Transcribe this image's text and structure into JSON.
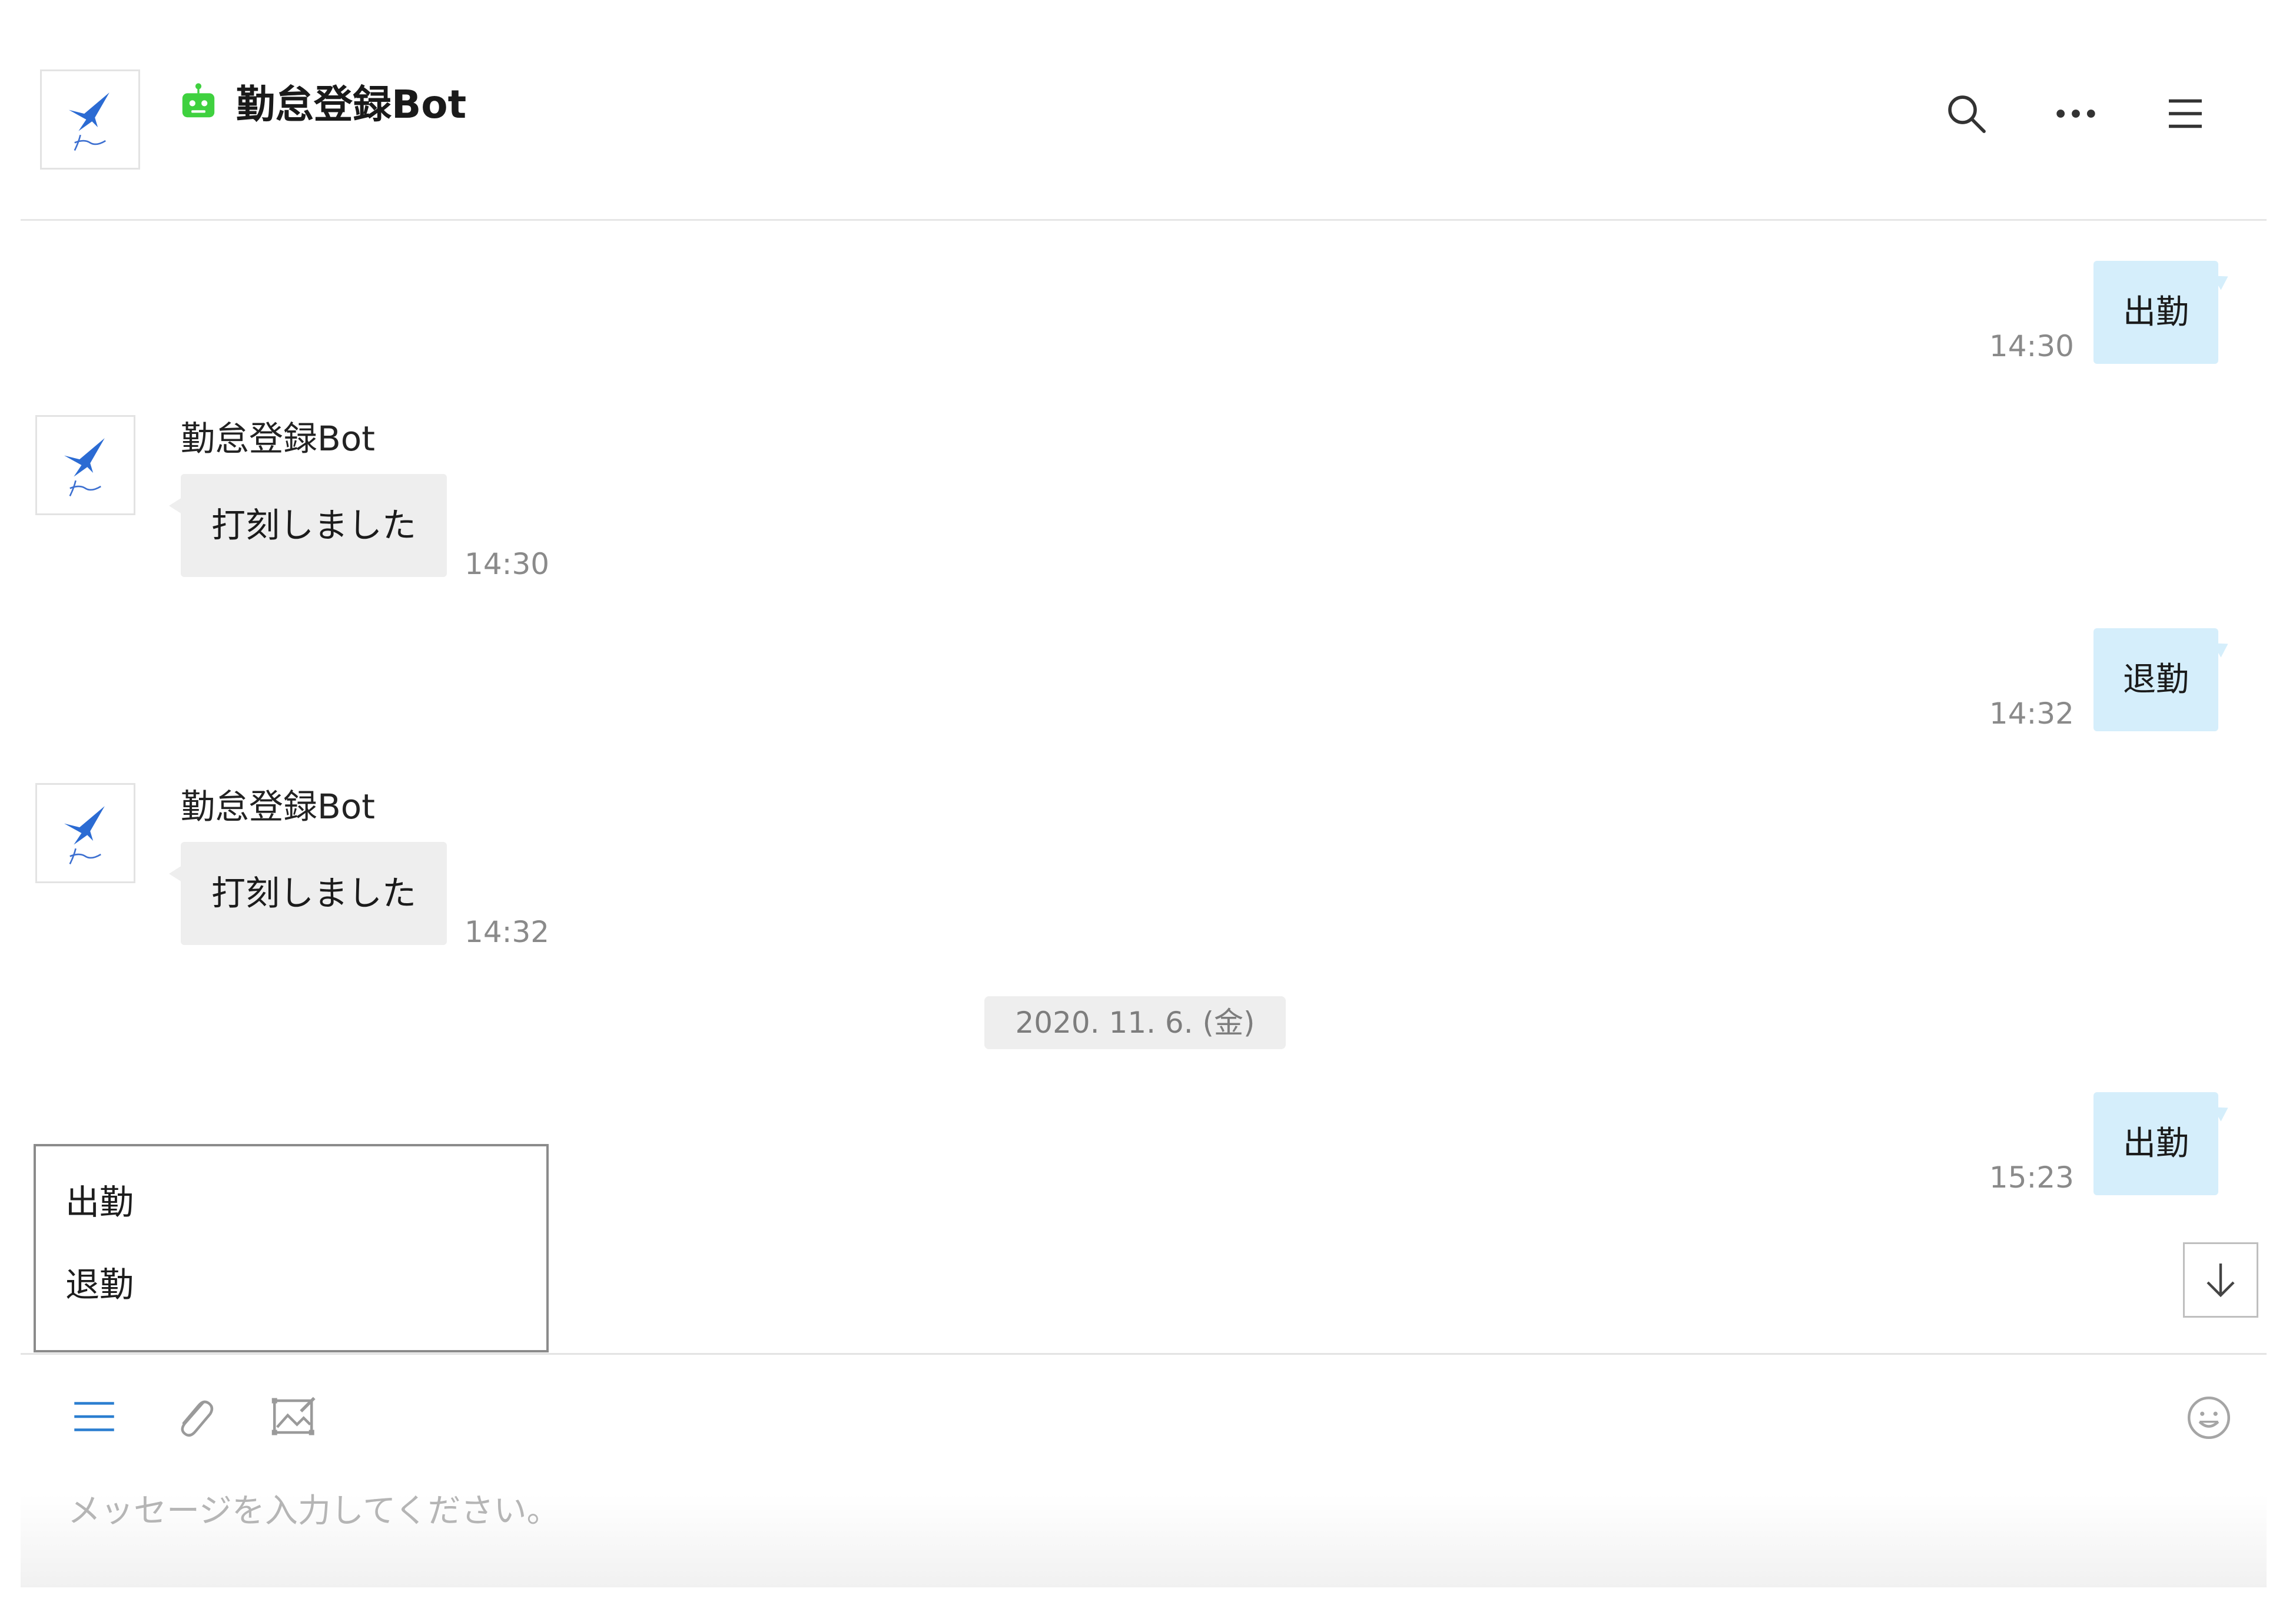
{
  "header": {
    "title": "勤怠登録Bot"
  },
  "icons": {
    "avatar": "swallow-logo-icon",
    "bot_badge": "robot-icon",
    "search": "search-icon",
    "more": "more-dots-icon",
    "menu": "hamburger-menu-icon",
    "scroll_down": "arrow-down-icon",
    "rich_menu": "list-icon",
    "attach": "paperclip-icon",
    "image": "image-edit-icon",
    "emoji": "emoji-icon"
  },
  "colors": {
    "my_bubble": "#d5eefb",
    "bot_bubble": "#eeeeee",
    "accent": "#2b7ed0",
    "bot_badge": "#3fd13f"
  },
  "messages": [
    {
      "side": "right",
      "text": "出勤",
      "time": "14:30"
    },
    {
      "side": "left",
      "sender": "勤怠登録Bot",
      "text": "打刻しました",
      "time": "14:30"
    },
    {
      "side": "right",
      "text": "退勤",
      "time": "14:32"
    },
    {
      "side": "left",
      "sender": "勤怠登録Bot",
      "text": "打刻しました",
      "time": "14:32"
    },
    {
      "side": "right",
      "text": "出勤",
      "time": "15:23"
    }
  ],
  "date_separator": "2020. 11. 6. (金)",
  "quick_menu": {
    "items": [
      "出勤",
      "退勤"
    ]
  },
  "composer": {
    "placeholder": "メッセージを入力してください。"
  }
}
